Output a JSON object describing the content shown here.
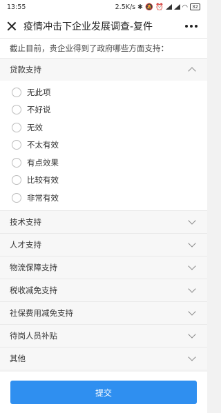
{
  "status_bar": {
    "time": "13:55",
    "network_speed": "2.5K/s",
    "icons": [
      "bluetooth-icon",
      "mute-icon",
      "alarm-icon",
      "signal-icon",
      "signal-icon",
      "wifi-icon"
    ],
    "battery": "32"
  },
  "header": {
    "title": "疫情冲击下企业发展调查-复件"
  },
  "question": {
    "text": "截止目前，贵企业得到了政府哪些方面支持："
  },
  "sections": [
    {
      "label": "贷款支持",
      "expanded": true,
      "options": [
        "无此项",
        "不好说",
        "无效",
        "不太有效",
        "有点效果",
        "比较有效",
        "非常有效"
      ]
    },
    {
      "label": "技术支持",
      "expanded": false
    },
    {
      "label": "人才支持",
      "expanded": false
    },
    {
      "label": "物流保障支持",
      "expanded": false
    },
    {
      "label": "税收减免支持",
      "expanded": false
    },
    {
      "label": "社保费用减免支持",
      "expanded": false
    },
    {
      "label": "待岗人员补贴",
      "expanded": false
    },
    {
      "label": "其他",
      "expanded": false
    }
  ],
  "footer": {
    "submit_label": "提交"
  },
  "colors": {
    "primary": "#2f8ff0"
  }
}
